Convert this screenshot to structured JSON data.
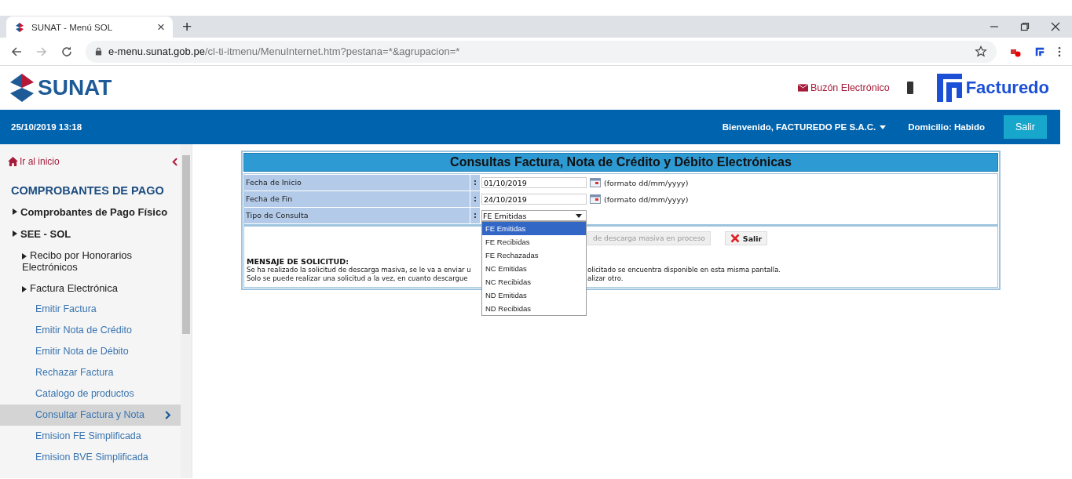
{
  "browser": {
    "tab": {
      "title": "SUNAT - Menú SOL",
      "close": "×"
    },
    "new_tab": "+",
    "url": {
      "host": "e-menu.sunat.gob.pe",
      "path": "/cl-ti-itmenu/MenuInternet.htm?pestana=*&agrupacion=*"
    }
  },
  "header": {
    "logo": "SUNAT",
    "mailbox": "Buzón Electrónico",
    "brand": "Facturedo"
  },
  "top_bar": {
    "datetime": "25/10/2019 13:18",
    "welcome": "Bienvenido, FACTUREDO PE S.A.C.",
    "domicile": "Domicilio: Habido",
    "logout": "Salir"
  },
  "sidebar": {
    "home": "Ir al inicio",
    "section": "COMPROBANTES DE PAGO",
    "items": [
      {
        "label": "Comprobantes de Pago Físico",
        "kind": "folder"
      },
      {
        "label": "SEE - SOL",
        "kind": "folder",
        "children": [
          {
            "label": "Recibo por Honorarios Electrónicos",
            "kind": "folder"
          },
          {
            "label": "Factura Electrónica",
            "kind": "folder",
            "children": [
              {
                "label": "Emitir Factura",
                "kind": "link",
                "selected": false
              },
              {
                "label": "Emitir Nota de Crédito",
                "kind": "link",
                "selected": false
              },
              {
                "label": "Emitir Nota de Débito",
                "kind": "link",
                "selected": false
              },
              {
                "label": "Rechazar Factura",
                "kind": "link",
                "selected": false
              },
              {
                "label": "Catalogo de productos",
                "kind": "link",
                "selected": false
              },
              {
                "label": "Consultar Factura y Nota",
                "kind": "link",
                "selected": true
              },
              {
                "label": "Emision FE Simplificada",
                "kind": "link",
                "selected": false
              },
              {
                "label": "Emision BVE Simplificada",
                "kind": "link",
                "selected": false
              }
            ]
          }
        ]
      }
    ]
  },
  "form": {
    "title": "Consultas Factura, Nota de Crédito y Débito Electrónicas",
    "fields": [
      {
        "label": "Fecha de Inicio",
        "separator": ":",
        "kind": "date",
        "value": "01/10/2019",
        "hint": "(formato dd/mm/yyyy)"
      },
      {
        "label": "Fecha de Fin",
        "separator": ":",
        "kind": "date",
        "value": "24/10/2019",
        "hint": "(formato dd/mm/yyyy)"
      },
      {
        "label": "Tipo de Consulta",
        "separator": ":",
        "kind": "select",
        "value": "FE Emitidas",
        "options": [
          {
            "label": "FE Emitidas",
            "selected": true
          },
          {
            "label": "FE Recibidas",
            "selected": false
          },
          {
            "label": "FE Rechazadas",
            "selected": false
          },
          {
            "label": "NC Emitidas",
            "selected": false
          },
          {
            "label": "NC Recibidas",
            "selected": false
          },
          {
            "label": "ND Emitidas",
            "selected": false
          },
          {
            "label": "ND Recibidas",
            "selected": false
          }
        ]
      }
    ],
    "buttons": [
      {
        "label": "de descarga masiva en proceso",
        "kind": "request",
        "disabled": true
      },
      {
        "label": "Salir",
        "kind": "exit",
        "disabled": false
      }
    ],
    "message": {
      "title": "MENSAJE DE SOLICITUD:",
      "lines": [
        {
          "left": "Se ha realizado la solicitud de descarga masiva, se le va a enviar u",
          "right": "olicitado se encuentra disponible en esta misma pantalla."
        },
        {
          "left": "Solo se puede realizar una solicitud a la vez, en cuanto descargue",
          "right": "alizar otro."
        }
      ]
    }
  }
}
